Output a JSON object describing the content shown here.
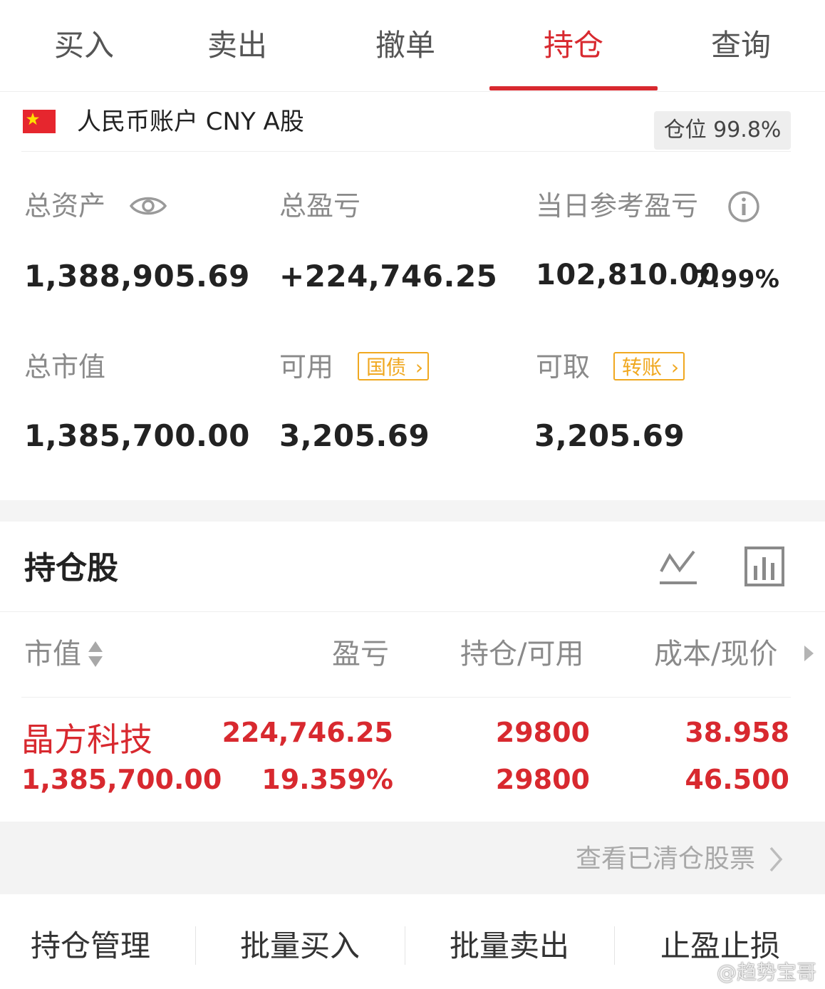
{
  "tabs": [
    {
      "label": "买入"
    },
    {
      "label": "卖出"
    },
    {
      "label": "撤单"
    },
    {
      "label": "持仓"
    },
    {
      "label": "查询"
    }
  ],
  "active_tab": "持仓",
  "account": {
    "title": "人民币账户 CNY A股",
    "position_label": "仓位 99.8%"
  },
  "summary": {
    "total_assets_label": "总资产",
    "total_assets": "1,388,905.69",
    "total_pnl_label": "总盈亏",
    "total_pnl": "+224,746.25",
    "daily_pnl_label": "当日参考盈亏",
    "daily_pnl": "102,810.00",
    "daily_pnl_pct": "7.99%",
    "market_value_label": "总市值",
    "market_value": "1,385,700.00",
    "available_label": "可用",
    "available_tag": "国债",
    "available": "3,205.69",
    "withdrawable_label": "可取",
    "withdrawable_tag": "转账",
    "withdrawable": "3,205.69"
  },
  "holdings": {
    "title": "持仓股",
    "columns": [
      "市值",
      "盈亏",
      "持仓/可用",
      "成本/现价"
    ],
    "rows": [
      {
        "name": "晶方科技",
        "market_value": "1,385,700.00",
        "pnl": "224,746.25",
        "pnl_pct": "19.359%",
        "position": "29800",
        "available": "29800",
        "cost": "38.958",
        "price": "46.500"
      }
    ],
    "cleared_link": "查看已清仓股票"
  },
  "bottom_bar": [
    "持仓管理",
    "批量买入",
    "批量卖出",
    "止盈止损"
  ],
  "watermark": "@趋势宝哥",
  "colors": {
    "accent": "#d8292f",
    "tag": "#f0a820",
    "muted": "#8a8a8a"
  }
}
